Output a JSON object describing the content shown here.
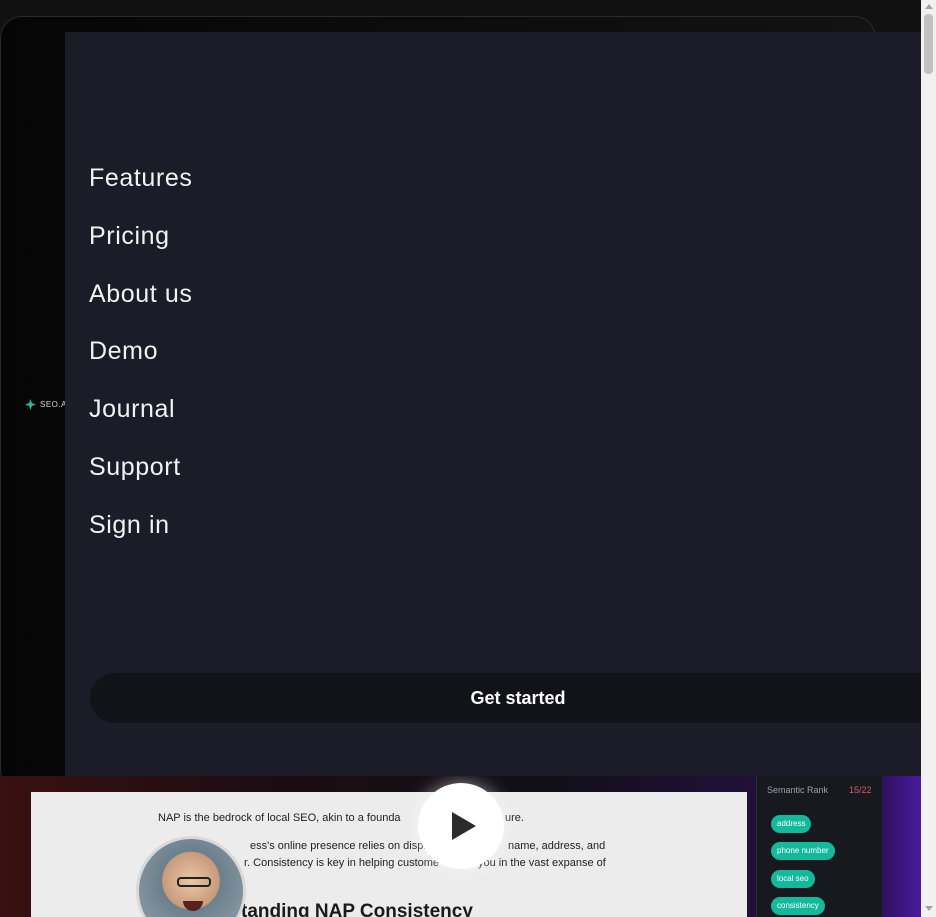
{
  "background": {
    "logo_text": "SEO.AI",
    "doc_lines": [
      "NAP is the bedrock of local SEO, akin to a founda",
      "ure.",
      "ess's online presence relies on displayir",
      "name, address, and",
      "r. Consistency is key in helping custome",
      "you in the vast expanse of"
    ],
    "doc_heading": "tanding NAP Consistency",
    "side_panel": {
      "heading": "Semantic Rank",
      "number": "15/22",
      "tags": [
        "address",
        "phone number",
        "local seo",
        "consistency"
      ]
    }
  },
  "menu": {
    "items": [
      "Features",
      "Pricing",
      "About us",
      "Demo",
      "Journal",
      "Support",
      "Sign in"
    ],
    "cta_label": "Get started"
  },
  "colors": {
    "panel": "#1c1c28",
    "cta": "#121219",
    "tag": "#14b89a"
  }
}
